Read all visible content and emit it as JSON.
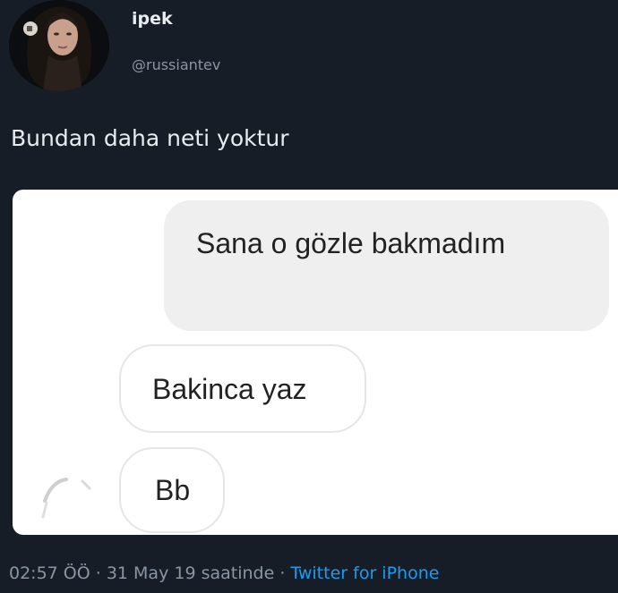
{
  "tweet": {
    "display_name": "ipek",
    "handle": "@russiantev",
    "text": "Bundan daha neti yoktur",
    "timestamp": "02:57 ÖÖ · 31 May 19 saatinde",
    "separator": " · ",
    "source": "Twitter for iPhone",
    "avatar_icon": "profile-photo"
  },
  "chat": {
    "sent_message": "Sana o gözle bakmadım",
    "received_messages": [
      "Bakinca yaz",
      "Bb"
    ],
    "contact_avatar_icon": "loading-avatar"
  },
  "colors": {
    "background": "#161d27",
    "text": "#e8ecf0",
    "muted": "#8a96a3",
    "link": "#1d9bf0",
    "chat_card": "#ffffff",
    "sent_bubble": "#efefef"
  }
}
